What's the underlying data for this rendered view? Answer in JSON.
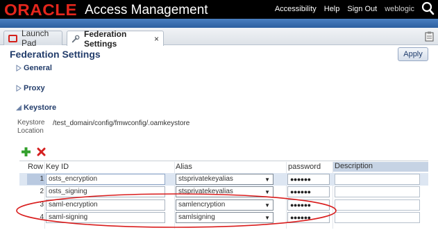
{
  "header": {
    "logo": "ORACLE",
    "product": "Access Management",
    "nav": [
      "Accessibility",
      "Help",
      "Sign Out",
      "weblogic"
    ]
  },
  "tabs": [
    {
      "label": "Launch Pad"
    },
    {
      "label": "Federation Settings",
      "close": "×"
    }
  ],
  "page": {
    "title": "Federation Settings",
    "apply_label": "Apply"
  },
  "sections": {
    "general": "General",
    "proxy": "Proxy",
    "keystore": "Keystore"
  },
  "keystore": {
    "location_label": "Keystore Location",
    "location_value": "/test_domain/config/fmwconfig/.oamkeystore"
  },
  "table": {
    "headers": {
      "row": "Row",
      "key_id": "Key ID",
      "alias": "Alias",
      "password": "password",
      "description": "Description"
    },
    "rows": [
      {
        "row": "1",
        "key_id": "osts_encryption",
        "alias": "stsprivatekeyalias",
        "password": "●●●●●●",
        "description": ""
      },
      {
        "row": "2",
        "key_id": "osts_signing",
        "alias": "stsprivatekeyalias",
        "password": "●●●●●●",
        "description": ""
      },
      {
        "row": "3",
        "key_id": "saml-encryption",
        "alias": "samlencryption",
        "password": "●●●●●●",
        "description": ""
      },
      {
        "row": "4",
        "key_id": "saml-signing",
        "alias": "samlsigning",
        "password": "●●●●●●",
        "description": ""
      }
    ]
  },
  "icons": {
    "search": "search-icon",
    "wrench": "wrench-icon",
    "add": "add-icon",
    "delete": "delete-icon",
    "clipboard": "clipboard-icon"
  },
  "colors": {
    "brand_red": "#e4261c",
    "accent_blue": "#2c5f9f",
    "title_blue": "#233d6b",
    "annotation_red": "#d91c1c"
  }
}
